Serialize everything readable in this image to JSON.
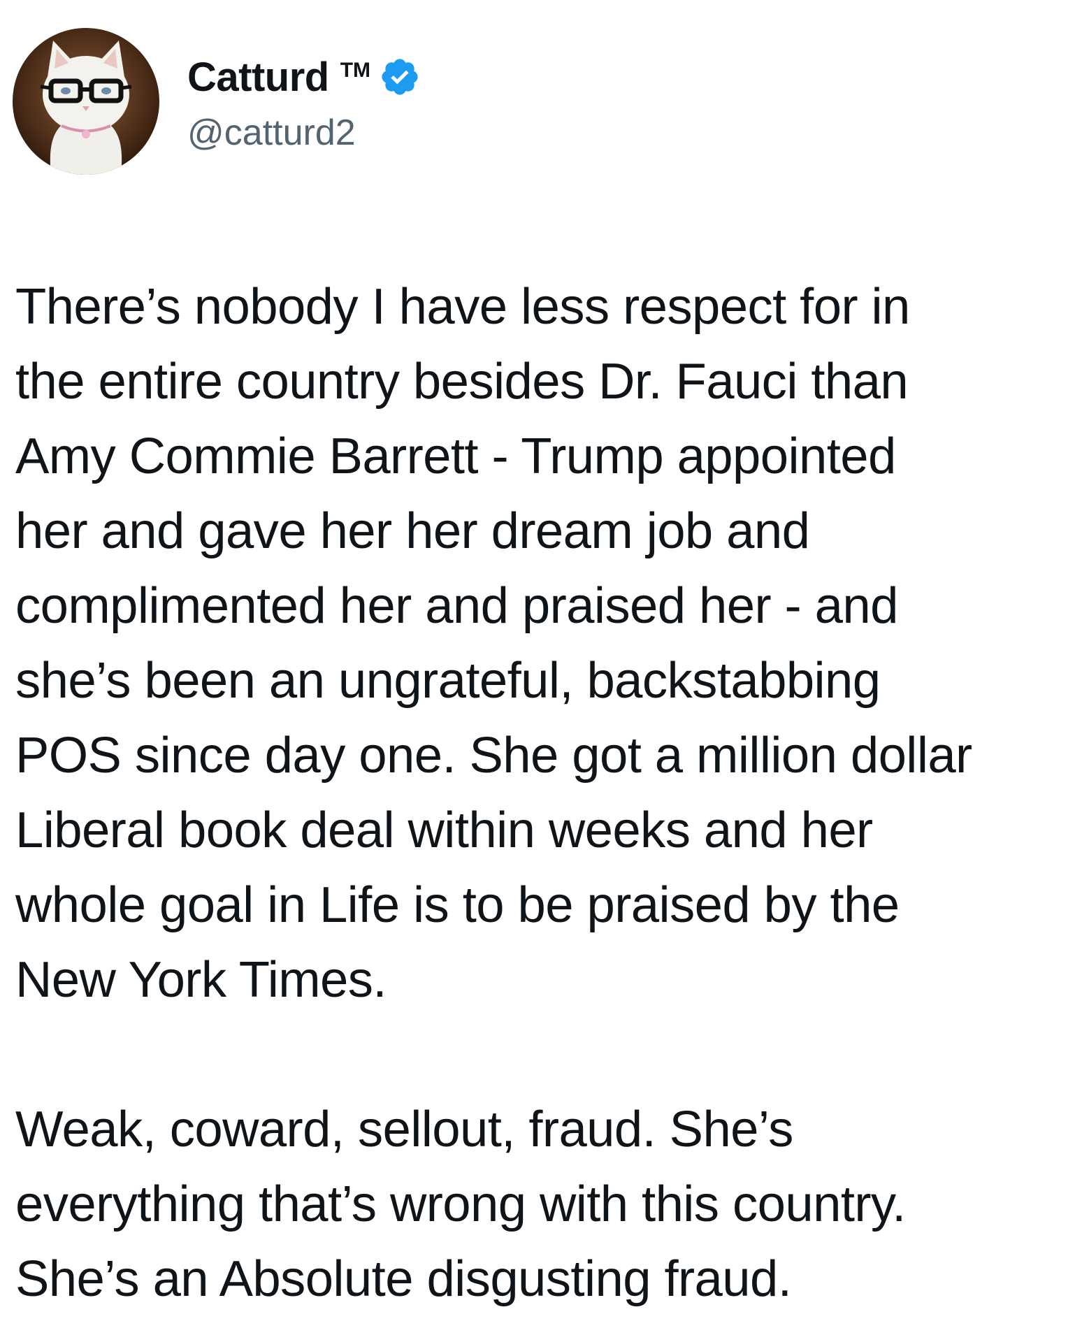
{
  "tweet": {
    "author": {
      "display_name": "Catturd",
      "trademark": "TM",
      "handle": "@catturd2",
      "verified": true,
      "verified_badge_color": "#1d9bf0",
      "avatar_icon": "white-cat-with-glasses-avatar"
    },
    "body": {
      "paragraph_1": "There’s nobody I have less respect for in\nthe entire country besides Dr. Fauci than\nAmy Commie Barrett - Trump appointed\nher and gave her her dream job and\ncomplimented her and praised her - and\nshe’s been an ungrateful, backstabbing\nPOS since day one. She got a million dollar\nLiberal book deal within weeks and her\nwhole goal in Life is to be praised by the\nNew York Times.",
      "paragraph_2": "Weak, coward, sellout, fraud. She’s\neverything that’s wrong with this country.\nShe’s an Absolute disgusting fraud."
    }
  }
}
